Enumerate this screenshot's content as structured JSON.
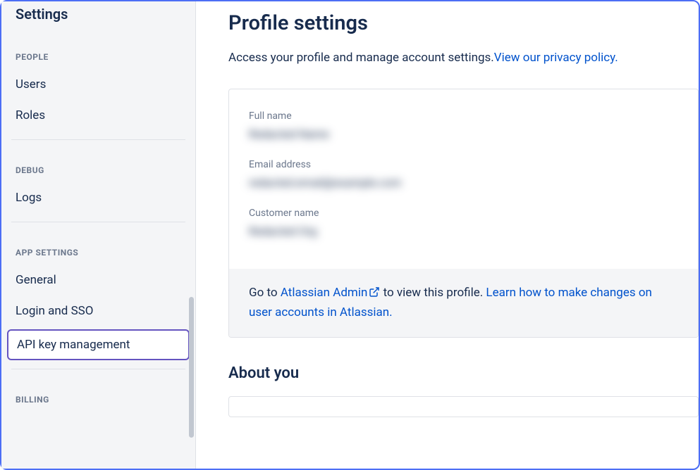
{
  "sidebar": {
    "title": "Settings",
    "sections": [
      {
        "header": "PEOPLE",
        "items": [
          "Users",
          "Roles"
        ]
      },
      {
        "header": "DEBUG",
        "items": [
          "Logs"
        ]
      },
      {
        "header": "APP SETTINGS",
        "items": [
          "General",
          "Login and SSO",
          "API key management"
        ]
      },
      {
        "header": "BILLING",
        "items": []
      }
    ],
    "active_item": "API key management"
  },
  "main": {
    "title": "Profile settings",
    "description": "Access your profile and manage account settings.",
    "privacy_link": "View our privacy policy.",
    "fields": [
      {
        "label": "Full name",
        "value": "Redacted Name"
      },
      {
        "label": "Email address",
        "value": "redacted.email@example.com"
      },
      {
        "label": "Customer name",
        "value": "Redacted Org"
      }
    ],
    "footer": {
      "prefix": "Go to ",
      "admin_link": "Atlassian Admin",
      "mid": " to view this profile. ",
      "learn_link": "Learn how to make changes on user accounts in Atlassian."
    },
    "about_title": "About you"
  }
}
